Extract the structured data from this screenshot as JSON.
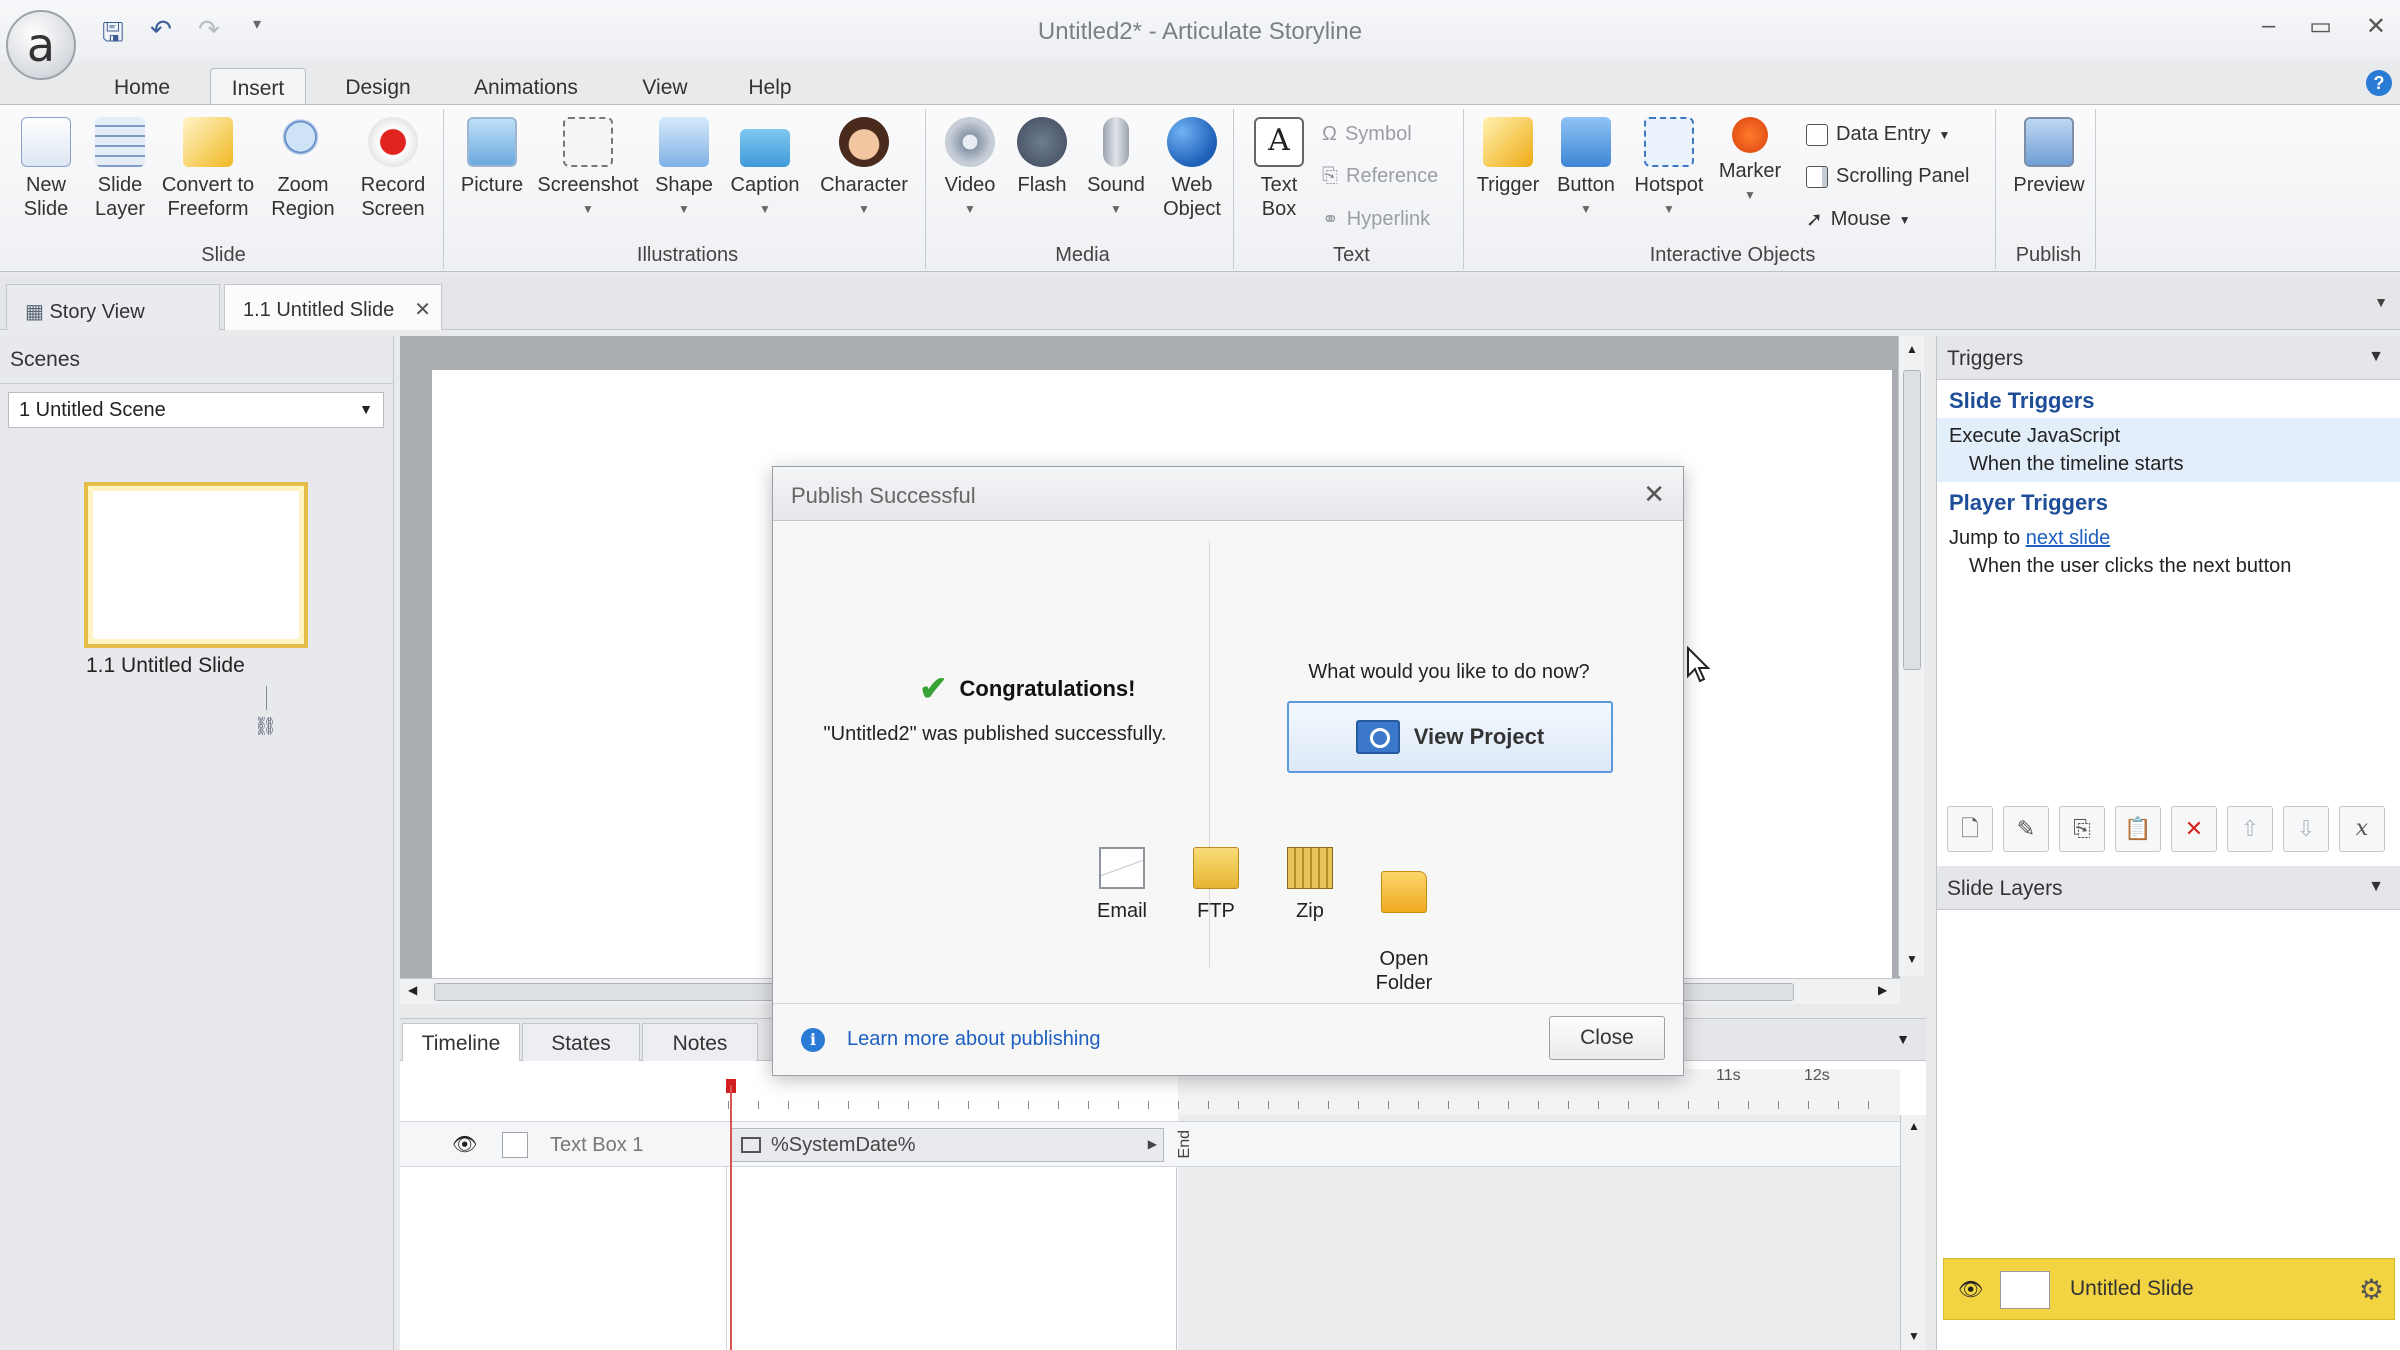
{
  "app": {
    "window_title": "Untitled2* -  Articulate Storyline",
    "logo_glyph": "a"
  },
  "ribbon_tabs": [
    "Home",
    "Insert",
    "Design",
    "Animations",
    "View",
    "Help"
  ],
  "ribbon": {
    "slide": {
      "label": "Slide",
      "new_slide": "New\nSlide",
      "slide_layer": "Slide\nLayer",
      "convert": "Convert to\nFreeform",
      "zoom": "Zoom\nRegion",
      "record": "Record\nScreen"
    },
    "illustrations": {
      "label": "Illustrations",
      "picture": "Picture",
      "screenshot": "Screenshot",
      "shape": "Shape",
      "caption": "Caption",
      "character": "Character"
    },
    "media": {
      "label": "Media",
      "video": "Video",
      "flash": "Flash",
      "sound": "Sound",
      "web_object": "Web\nObject"
    },
    "text": {
      "label": "Text",
      "text_box": "Text\nBox",
      "symbol": "Symbol",
      "reference": "Reference",
      "hyperlink": "Hyperlink"
    },
    "interactive": {
      "label": "Interactive Objects",
      "trigger": "Trigger",
      "button": "Button",
      "hotspot": "Hotspot",
      "marker": "Marker",
      "data_entry": "Data Entry",
      "scrolling_panel": "Scrolling Panel",
      "mouse": "Mouse"
    },
    "publish": {
      "label": "Publish",
      "preview": "Preview"
    }
  },
  "doc_tabs": {
    "story_view": "Story View",
    "slide_tab": "1.1 Untitled Slide"
  },
  "scenes": {
    "header": "Scenes",
    "selected_scene": "1 Untitled Scene",
    "slide_label": "1.1 Untitled Slide"
  },
  "timeline": {
    "tabs": [
      "Timeline",
      "States",
      "Notes"
    ],
    "row_name": "Text Box 1",
    "bar_text": "%SystemDate%",
    "end_label": "End",
    "ticks": [
      "11s",
      "12s"
    ]
  },
  "triggers": {
    "header": "Triggers",
    "slide_triggers_heading": "Slide Triggers",
    "slide_trigger_action": "Execute JavaScript",
    "slide_trigger_condition": "When the timeline starts",
    "player_triggers_heading": "Player Triggers",
    "player_trigger_action_prefix": "Jump to ",
    "player_trigger_link": "next slide",
    "player_trigger_condition": "When the user clicks the next button"
  },
  "slide_layers": {
    "header": "Slide Layers",
    "base_layer": "Untitled Slide"
  },
  "dialog": {
    "title": "Publish Successful",
    "congrats": "Congratulations!",
    "message": "\"Untitled2\" was published successfully.",
    "question": "What would you like to do now?",
    "view_project": "View Project",
    "options": [
      "Email",
      "FTP",
      "Zip",
      "Open\nFolder"
    ],
    "learn_more": "Learn more about publishing",
    "close": "Close"
  },
  "colors": {
    "accent_blue": "#1f4e99",
    "link_blue": "#1f5fbf",
    "selected_layer": "#f2d443",
    "success_green": "#3aa337"
  }
}
